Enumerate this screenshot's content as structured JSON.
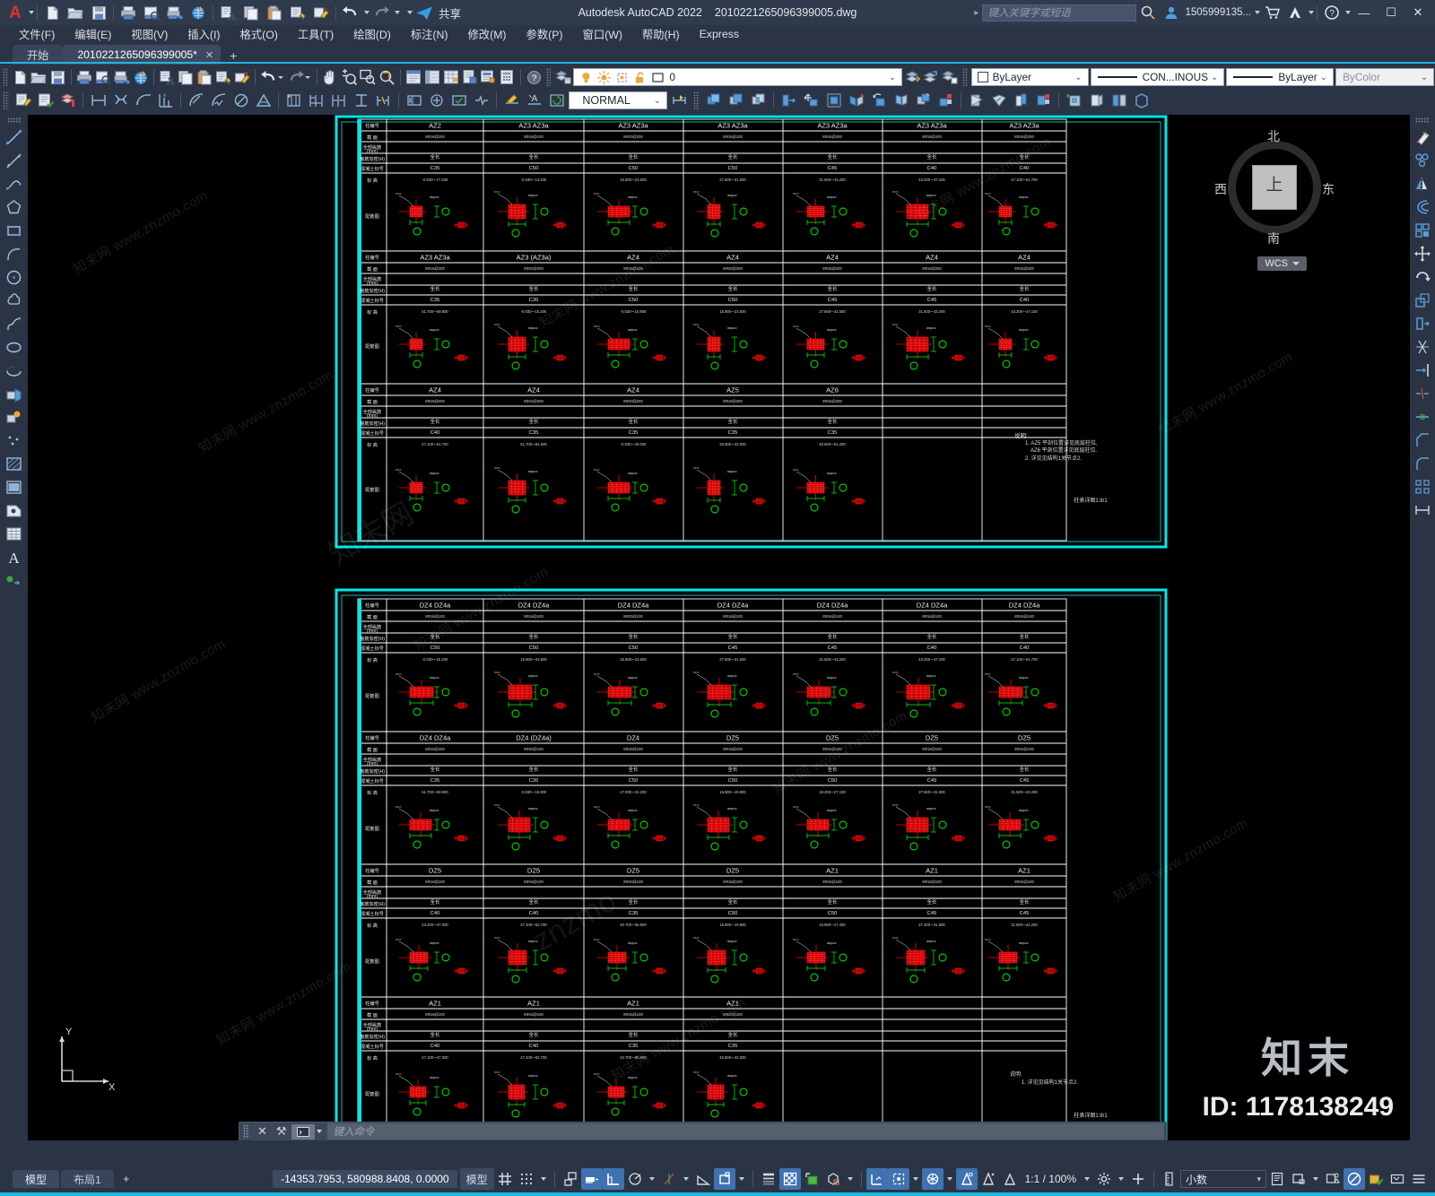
{
  "titlebar": {
    "app_title": "Autodesk AutoCAD 2022",
    "file_name": "2010221265096399005.dwg",
    "share_label": "共享",
    "search_placeholder": "键入关键字或短语",
    "user_account": "1505999135...",
    "minimize": "—",
    "maximize": "☐",
    "close": "✕",
    "quick_access_icons": [
      "autocad-logo",
      "new-file",
      "open-file",
      "save",
      "print",
      "print-preview",
      "plot",
      "render",
      "cut",
      "copy",
      "paste",
      "match-properties",
      "erase",
      "undo",
      "redo",
      "pan",
      "zoom",
      "zoom-window",
      "zoom-previous"
    ]
  },
  "menubar": {
    "items": [
      {
        "label": "文件(F)",
        "name": "menu-file"
      },
      {
        "label": "编辑(E)",
        "name": "menu-edit"
      },
      {
        "label": "视图(V)",
        "name": "menu-view"
      },
      {
        "label": "插入(I)",
        "name": "menu-insert"
      },
      {
        "label": "格式(O)",
        "name": "menu-format"
      },
      {
        "label": "工具(T)",
        "name": "menu-tools"
      },
      {
        "label": "绘图(D)",
        "name": "menu-draw"
      },
      {
        "label": "标注(N)",
        "name": "menu-dimension"
      },
      {
        "label": "修改(M)",
        "name": "menu-modify"
      },
      {
        "label": "参数(P)",
        "name": "menu-parameter"
      },
      {
        "label": "窗口(W)",
        "name": "menu-window"
      },
      {
        "label": "帮助(H)",
        "name": "menu-help"
      },
      {
        "label": "Express",
        "name": "menu-express"
      }
    ]
  },
  "tabs": {
    "start_tab": "开始",
    "doc_tab": "2010221265096399005*",
    "close_glyph": "✕",
    "add_glyph": "+"
  },
  "toolbar": {
    "layer_value": "0",
    "layer_dropdown_caret": "⌄",
    "bylayer_color": "ByLayer",
    "linetype": "CON...INOUS",
    "bylayer_lineweight": "ByLayer",
    "bycolor_plotstyle": "ByColor",
    "dim_style": "NORMAL"
  },
  "viewcube": {
    "north": "北",
    "south": "南",
    "west": "西",
    "east": "东",
    "top": "上",
    "wcs_label": "WCS"
  },
  "drawing": {
    "note_title": "说明:",
    "note_line1": "1. AZ5 平剖位置详见底层柱位,",
    "note_line2": "AZ6 平剖位置详见底层柱位.",
    "note_line3": "2. 详见见结构1关节点2.",
    "note2_line1": "说明:",
    "note2_line2": "1. 详见见结构1关节点2.",
    "scale_label": "柱表详图1:8/1",
    "scale_label2": "柱表详图1:8/1",
    "table1": {
      "row_headers": [
        "柱编号",
        "截 面",
        "全部纵筋(净面)(mm)",
        "箍筋加密区(H)",
        "混凝土标号",
        "标 高",
        "配筋图"
      ],
      "groups": [
        {
          "cells": [
            {
              "id": "AZ2",
              "rebar": "8Φ16@200",
              "stirrup": "全长",
              "concrete": "C35",
              "elev": "-0.030~-17.000"
            },
            {
              "id": "AZ3  AZ3a",
              "rebar": "8Φ16@100",
              "stirrup": "全长",
              "concrete": "C50",
              "elev": "-0.030~-13.200"
            },
            {
              "id": "AZ3  AZ3a",
              "rebar": "8Φ20@200",
              "stirrup": "全长",
              "concrete": "C50",
              "elev": "15.900~-23.600"
            },
            {
              "id": "AZ3  AZ3a",
              "rebar": "8Φ16@100",
              "stirrup": "全长",
              "concrete": "C50",
              "elev": "27.600~-31.500"
            },
            {
              "id": "AZ3  AZ3a",
              "rebar": "8Φ16@200",
              "stirrup": "全长",
              "concrete": "C45",
              "elev": "31.500~-43.200"
            },
            {
              "id": "AZ3  AZ3a",
              "rebar": "8Φ16@200",
              "stirrup": "全长",
              "concrete": "C40",
              "elev": "43.200~-47.100"
            },
            {
              "id": "AZ3  AZ3a",
              "rebar": "8Φ16@200",
              "stirrup": "全长",
              "concrete": "C40",
              "elev": "47.100~-51.700"
            }
          ]
        },
        {
          "cells": [
            {
              "id": "AZ3  AZ3a",
              "rebar": "8Φ16@200",
              "stirrup": "全长",
              "concrete": "C35",
              "elev": "51.700~-69.600"
            },
            {
              "id": "AZ3 (AZ3a)",
              "rebar": "8Φ20@200",
              "stirrup": "全长",
              "concrete": "C35",
              "elev": "-0.030~-15.200"
            },
            {
              "id": "AZ4",
              "rebar": "8Φ16@100",
              "stirrup": "全长",
              "concrete": "C50",
              "elev": "-0.030~-15.900"
            },
            {
              "id": "AZ4",
              "rebar": "8Φ20@200",
              "stirrup": "全长",
              "concrete": "C50",
              "elev": "15.900~-23.500"
            },
            {
              "id": "AZ4",
              "rebar": "8Φ16@200",
              "stirrup": "全长",
              "concrete": "C45",
              "elev": "27.600~-31.500"
            },
            {
              "id": "AZ4",
              "rebar": "8Φ16@200",
              "stirrup": "全长",
              "concrete": "C45",
              "elev": "31.500~-43.200"
            },
            {
              "id": "AZ4",
              "rebar": "8Φ16@200",
              "stirrup": "全长",
              "concrete": "C40",
              "elev": "43.200~-47.100"
            }
          ]
        },
        {
          "cells": [
            {
              "id": "AZ4",
              "rebar": "8Φ16@200",
              "stirrup": "全长",
              "concrete": "C40",
              "elev": "47.100~-51.700"
            },
            {
              "id": "AZ4",
              "rebar": "8Φ16@200",
              "stirrup": "全长",
              "concrete": "C35",
              "elev": "51.700~-64.600"
            },
            {
              "id": "AZ4",
              "rebar": "8Φ20@200",
              "stirrup": "全长",
              "concrete": "C35",
              "elev": "-0.030~-40.000"
            },
            {
              "id": "AZ5",
              "rebar": "8Φ16@200",
              "stirrup": "全长",
              "concrete": "C35",
              "elev": "20.500~-42.000"
            },
            {
              "id": "AZ6",
              "rebar": "8Φ16@200",
              "stirrup": "全长",
              "concrete": "C35",
              "elev": "40.600~-51.200"
            }
          ]
        }
      ]
    },
    "table2": {
      "row_headers": [
        "柱编号",
        "截 面",
        "全部纵筋(净面)(mm)",
        "箍筋加密区(H)",
        "混凝土标号",
        "标 高",
        "配筋图"
      ],
      "groups": [
        {
          "cells": [
            {
              "id": "DZ4  DZ4a",
              "rebar": "8Φ16@100",
              "stirrup": "全长",
              "concrete": "C50",
              "elev": "-0.030~-15.200"
            },
            {
              "id": "DZ4  DZ4a",
              "rebar": "8Φ16@100",
              "stirrup": "全长",
              "concrete": "C50",
              "elev": "15.900~-23.600"
            },
            {
              "id": "DZ4  DZ4a",
              "rebar": "8Φ20@100",
              "stirrup": "全长",
              "concrete": "C50",
              "elev": "15.900~-23.600"
            },
            {
              "id": "DZ4  DZ4a",
              "rebar": "8Φ16@100",
              "stirrup": "全长",
              "concrete": "C45",
              "elev": "27.600~-31.500"
            },
            {
              "id": "DZ4  DZ4a",
              "rebar": "8Φ16@100",
              "stirrup": "全长",
              "concrete": "C45",
              "elev": "31.500~-43.200"
            },
            {
              "id": "DZ4  DZ4a",
              "rebar": "8Φ16@100",
              "stirrup": "全长",
              "concrete": "C40",
              "elev": "43.200~-47.100"
            },
            {
              "id": "DZ4  DZ4a",
              "rebar": "8Φ16@100",
              "stirrup": "全长",
              "concrete": "C40",
              "elev": "47.100~-51.700"
            }
          ]
        },
        {
          "cells": [
            {
              "id": "DZ4  DZ4a",
              "rebar": "8Φ16@100",
              "stirrup": "全长",
              "concrete": "C35",
              "elev": "51.700~-69.600"
            },
            {
              "id": "DZ4 (DZ4a)",
              "rebar": "8Φ20@100",
              "stirrup": "全长",
              "concrete": "C35",
              "elev": "-0.030~-15.900"
            },
            {
              "id": "DZ4",
              "rebar": "8Φ16@100",
              "stirrup": "全长",
              "concrete": "C50",
              "elev": "27.000~-31.200"
            },
            {
              "id": "DZ5",
              "rebar": "8Φ16@100",
              "stirrup": "全长",
              "concrete": "C50",
              "elev": "15.900~-19.900"
            },
            {
              "id": "DZ5",
              "rebar": "8Φ16@100",
              "stirrup": "全长",
              "concrete": "C50",
              "elev": "19.200~-27.100"
            },
            {
              "id": "DZ5",
              "rebar": "8Φ16@100",
              "stirrup": "全长",
              "concrete": "C45",
              "elev": "27.600~-31.500"
            },
            {
              "id": "DZ5",
              "rebar": "8Φ16@100",
              "stirrup": "全长",
              "concrete": "C45",
              "elev": "31.500~-43.200"
            }
          ]
        },
        {
          "cells": [
            {
              "id": "DZ5",
              "rebar": "8Φ16@100",
              "stirrup": "全长",
              "concrete": "C40",
              "elev": "43.200~-47.000"
            },
            {
              "id": "DZ5",
              "rebar": "8Φ16@100",
              "stirrup": "全长",
              "concrete": "C40",
              "elev": "47.100~-62.700"
            },
            {
              "id": "DZ5",
              "rebar": "8Φ20@100",
              "stirrup": "全长",
              "concrete": "C35",
              "elev": "40.700~-56.800"
            },
            {
              "id": "DZ5",
              "rebar": "8Φ16@100",
              "stirrup": "全长",
              "concrete": "C50",
              "elev": "15.900~-19.900"
            },
            {
              "id": "AZ1",
              "rebar": "8Φ16@100",
              "stirrup": "全长",
              "concrete": "C50",
              "elev": "15.900~-17.400"
            },
            {
              "id": "AZ1",
              "rebar": "8Φ16@100",
              "stirrup": "全长",
              "concrete": "C45",
              "elev": "27.400~-31.500"
            },
            {
              "id": "AZ1",
              "rebar": "8Φ16@100",
              "stirrup": "全长",
              "concrete": "C45",
              "elev": "31.500~-43.200"
            }
          ]
        },
        {
          "cells": [
            {
              "id": "AZ1",
              "rebar": "8Φ16@100",
              "stirrup": "全长",
              "concrete": "C40",
              "elev": "47.100~-47.000"
            },
            {
              "id": "AZ1",
              "rebar": "8Φ16@100",
              "stirrup": "全长",
              "concrete": "C40",
              "elev": "47.100~-62.700"
            },
            {
              "id": "AZ1",
              "rebar": "8Φ16@100",
              "stirrup": "全长",
              "concrete": "C35",
              "elev": "42.700~-56.800"
            },
            {
              "id": "AZ1",
              "rebar": "8Φ20@100",
              "stirrup": "全长",
              "concrete": "C35",
              "elev": "40.600~-42.000"
            }
          ]
        }
      ]
    }
  },
  "command_line": {
    "placeholder": "键入命令",
    "close_glyph": "✕",
    "tool_glyph": "⚒"
  },
  "statusbar": {
    "model_tab": "模型",
    "layout_tab": "布局1",
    "add_layout": "+",
    "coordinates": "-14353.7953, 580988.8408, 0.0000",
    "model_label": "模型",
    "scale": "1:1 / 100%",
    "units": "小数",
    "icons": [
      "grid-display",
      "snap-mode",
      "infer-constraints",
      "dynamic-input",
      "ortho-mode",
      "polar-tracking",
      "isometric-drafting",
      "object-snap-tracking",
      "object-snap",
      "lineweight",
      "transparency",
      "selection-cycling",
      "3d-object-snap",
      "dynamic-ucs",
      "selection-filtering",
      "gizmo",
      "annotation-visibility",
      "autoscale",
      "annotation-scale",
      "workspace-switching",
      "annotation-monitor",
      "units",
      "quick-properties",
      "lock-ui",
      "isolate-objects",
      "graphics-performance",
      "clean-screen",
      "customization"
    ]
  },
  "watermark": {
    "url": "知末网 www.znzmo.com",
    "brand": "知末",
    "id": "ID: 1178138249"
  },
  "colors": {
    "accent": "#1fb6e0",
    "chrome": "#2b3444",
    "titlebar": "#2f3a4c",
    "canvas": "#000000",
    "sheet_border": "#00e8e8",
    "rebar_red": "#ff0000",
    "dim_green": "#00ff00",
    "table_line": "#ffffff"
  }
}
